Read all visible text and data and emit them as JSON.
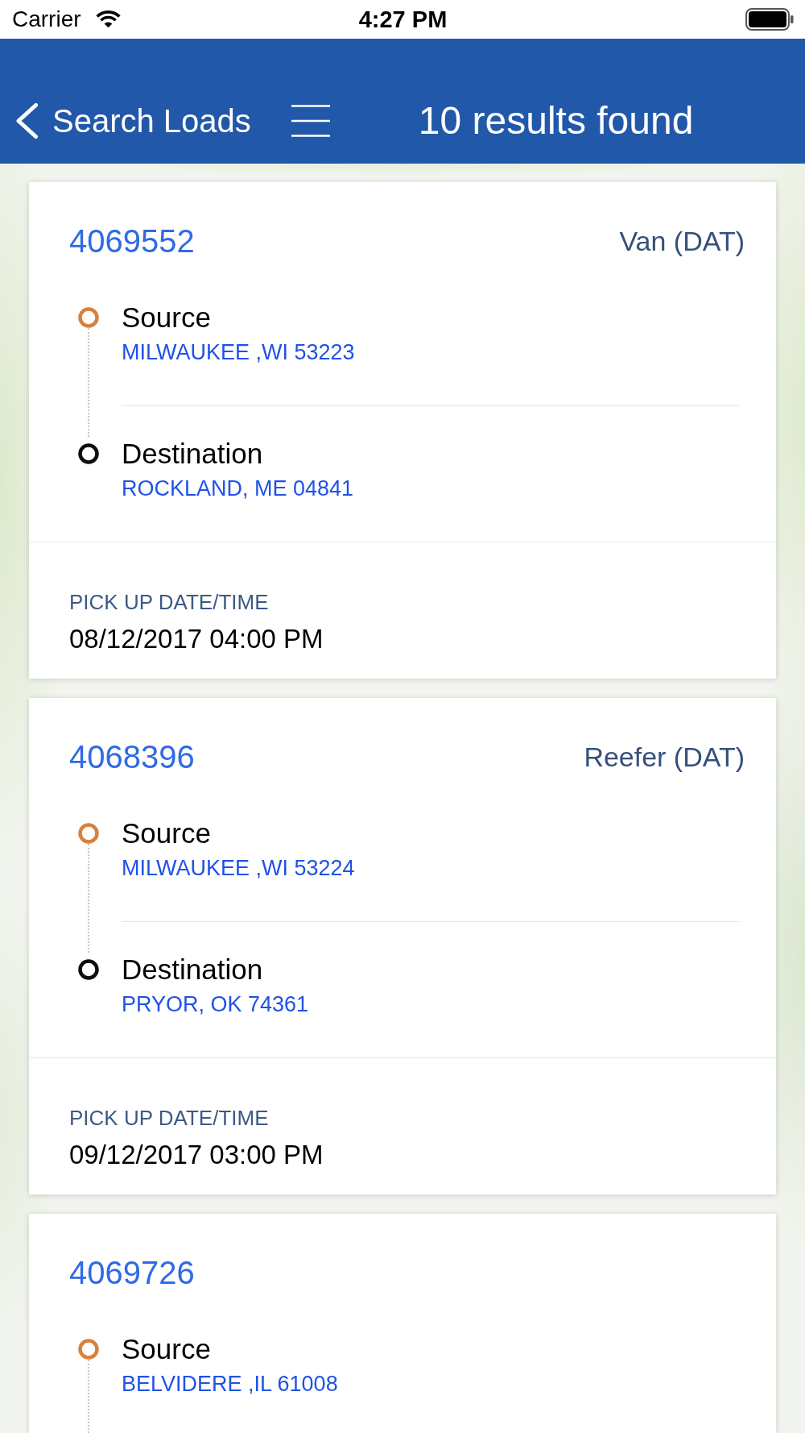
{
  "status_bar": {
    "carrier": "Carrier",
    "time": "4:27 PM"
  },
  "nav_bar": {
    "back_label": "Search Loads",
    "title": "10 results found"
  },
  "loads": [
    {
      "id": "4069552",
      "equipment": "Van (DAT)",
      "stops": [
        {
          "kind": "source",
          "label": "Source",
          "location": "MILWAUKEE ,WI 53223"
        },
        {
          "kind": "destination",
          "label": "Destination",
          "location": "ROCKLAND, ME 04841"
        }
      ],
      "pickup": {
        "label": "PICK UP DATE/TIME",
        "value": "08/12/2017 04:00 PM"
      }
    },
    {
      "id": "4068396",
      "equipment": "Reefer (DAT)",
      "stops": [
        {
          "kind": "source",
          "label": "Source",
          "location": "MILWAUKEE ,WI 53224"
        },
        {
          "kind": "destination",
          "label": "Destination",
          "location": "PRYOR, OK 74361"
        }
      ],
      "pickup": {
        "label": "PICK UP DATE/TIME",
        "value": "09/12/2017 03:00 PM"
      }
    },
    {
      "id": "4069726",
      "stops": [
        {
          "kind": "source",
          "label": "Source",
          "location": "BELVIDERE ,IL 61008"
        }
      ]
    }
  ]
}
